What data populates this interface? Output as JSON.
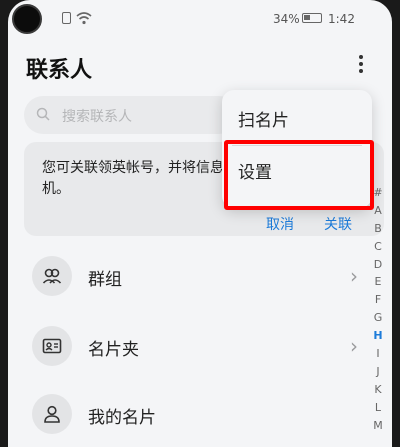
{
  "status_bar": {
    "battery": "34%",
    "time": "1:42"
  },
  "header": {
    "title": "联系人"
  },
  "search": {
    "placeholder": "搜索联系人"
  },
  "card": {
    "text": "您可关联领英帐号，并将信息同步至本机。",
    "cancel_label": "取消",
    "link_label": "关联"
  },
  "menu": {
    "items": [
      "扫名片",
      "设置"
    ]
  },
  "list": {
    "items": [
      {
        "label": "群组",
        "icon": "group-icon"
      },
      {
        "label": "名片夹",
        "icon": "card-holder-icon"
      },
      {
        "label": "我的名片",
        "icon": "person-icon"
      }
    ]
  },
  "index_letters": [
    "#",
    "A",
    "B",
    "C",
    "D",
    "E",
    "F",
    "G",
    "H",
    "I",
    "J",
    "K",
    "L",
    "M"
  ],
  "active_letter": "H",
  "colors": {
    "accent": "#1c7bd9",
    "highlight": "#ff0000"
  }
}
